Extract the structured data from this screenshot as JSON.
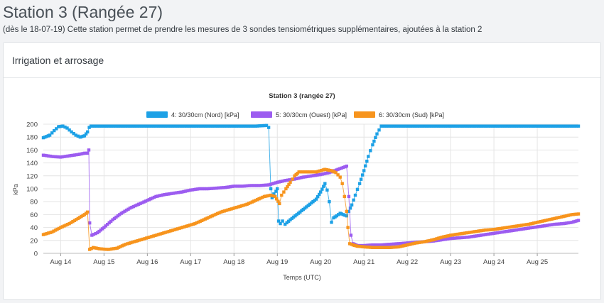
{
  "page": {
    "title": "Station 3 (Rangée 27)",
    "subtitle": "(dès le 18-07-19) Cette station permet de prendre les mesures de 3 sondes tensiométriques supplémentaires, ajoutées à la station 2"
  },
  "card": {
    "title": "Irrigation et arrosage"
  },
  "chart_data": {
    "type": "scatter",
    "title": "Station 3 (rangée 27)",
    "xlabel": "Temps (UTC)",
    "ylabel": "kPa",
    "ylim": [
      0,
      200
    ],
    "yticks": [
      0,
      20,
      40,
      60,
      80,
      100,
      120,
      140,
      160,
      180,
      200
    ],
    "xlim": [
      13.6,
      25.95
    ],
    "xticks": [
      {
        "x": 14,
        "label": "Aug 14"
      },
      {
        "x": 15,
        "label": "Aug 15"
      },
      {
        "x": 16,
        "label": "Aug 16"
      },
      {
        "x": 17,
        "label": "Aug 17"
      },
      {
        "x": 18,
        "label": "Aug 18"
      },
      {
        "x": 19,
        "label": "Aug 19"
      },
      {
        "x": 20,
        "label": "Aug 20"
      },
      {
        "x": 21,
        "label": "Aug 21"
      },
      {
        "x": 22,
        "label": "Aug 22"
      },
      {
        "x": 23,
        "label": "Aug 23"
      },
      {
        "x": 24,
        "label": "Aug 24"
      },
      {
        "x": 25,
        "label": "Aug 25"
      }
    ],
    "grid": true,
    "legend": "top-center",
    "series": [
      {
        "name": "4: 30/30cm (Nord) [kPa]",
        "color": "#1da1e6",
        "points": [
          [
            13.6,
            179
          ],
          [
            13.75,
            183
          ],
          [
            13.85,
            190
          ],
          [
            13.95,
            196
          ],
          [
            14.05,
            197
          ],
          [
            14.15,
            194
          ],
          [
            14.25,
            188
          ],
          [
            14.35,
            183
          ],
          [
            14.45,
            180
          ],
          [
            14.55,
            182
          ],
          [
            14.62,
            188
          ],
          [
            14.66,
            195
          ],
          [
            14.7,
            197
          ],
          [
            15.5,
            197
          ],
          [
            16.5,
            197
          ],
          [
            17.5,
            197
          ],
          [
            18.5,
            197
          ],
          [
            18.75,
            198
          ],
          [
            18.8,
            195
          ],
          [
            18.85,
            100
          ],
          [
            18.88,
            86
          ],
          [
            18.92,
            92
          ],
          [
            18.97,
            96
          ],
          [
            19.0,
            100
          ],
          [
            19.03,
            50
          ],
          [
            19.07,
            46
          ],
          [
            19.12,
            50
          ],
          [
            19.18,
            45
          ],
          [
            19.3,
            52
          ],
          [
            19.45,
            60
          ],
          [
            19.6,
            68
          ],
          [
            19.75,
            76
          ],
          [
            19.9,
            84
          ],
          [
            20.0,
            95
          ],
          [
            20.1,
            108
          ],
          [
            20.15,
            98
          ],
          [
            20.2,
            80
          ],
          [
            20.25,
            48
          ],
          [
            20.3,
            55
          ],
          [
            20.37,
            58
          ],
          [
            20.45,
            62
          ],
          [
            20.52,
            60
          ],
          [
            20.6,
            58
          ],
          [
            20.65,
            65
          ],
          [
            20.72,
            75
          ],
          [
            20.8,
            90
          ],
          [
            20.9,
            108
          ],
          [
            21.0,
            128
          ],
          [
            21.1,
            150
          ],
          [
            21.2,
            168
          ],
          [
            21.3,
            185
          ],
          [
            21.4,
            197
          ],
          [
            22.0,
            197
          ],
          [
            23.0,
            197
          ],
          [
            24.0,
            197
          ],
          [
            25.0,
            197
          ],
          [
            25.5,
            197
          ],
          [
            25.95,
            197
          ]
        ]
      },
      {
        "name": "5: 30/30cm (Ouest) [kPa]",
        "color": "#9c5cf0",
        "points": [
          [
            13.6,
            152
          ],
          [
            13.8,
            150
          ],
          [
            14.0,
            149
          ],
          [
            14.2,
            151
          ],
          [
            14.4,
            153
          ],
          [
            14.55,
            155
          ],
          [
            14.62,
            155
          ],
          [
            14.65,
            160
          ],
          [
            14.67,
            47
          ],
          [
            14.72,
            28
          ],
          [
            14.85,
            32
          ],
          [
            15.0,
            40
          ],
          [
            15.2,
            52
          ],
          [
            15.4,
            62
          ],
          [
            15.6,
            70
          ],
          [
            15.8,
            76
          ],
          [
            16.0,
            82
          ],
          [
            16.2,
            88
          ],
          [
            16.4,
            91
          ],
          [
            16.6,
            93
          ],
          [
            16.8,
            95
          ],
          [
            17.0,
            98
          ],
          [
            17.2,
            100
          ],
          [
            17.4,
            100
          ],
          [
            17.6,
            101
          ],
          [
            17.8,
            102
          ],
          [
            18.0,
            104
          ],
          [
            18.2,
            104
          ],
          [
            18.4,
            105
          ],
          [
            18.6,
            105
          ],
          [
            18.8,
            106
          ],
          [
            19.0,
            110
          ],
          [
            19.2,
            113
          ],
          [
            19.4,
            115
          ],
          [
            19.6,
            118
          ],
          [
            19.8,
            120
          ],
          [
            20.0,
            122
          ],
          [
            20.2,
            125
          ],
          [
            20.4,
            130
          ],
          [
            20.6,
            135
          ],
          [
            20.65,
            88
          ],
          [
            20.7,
            28
          ],
          [
            20.75,
            15
          ],
          [
            20.85,
            12
          ],
          [
            21.0,
            12
          ],
          [
            21.2,
            13
          ],
          [
            21.4,
            13
          ],
          [
            21.6,
            14
          ],
          [
            21.8,
            15
          ],
          [
            22.0,
            16
          ],
          [
            22.2,
            17
          ],
          [
            22.4,
            18
          ],
          [
            22.6,
            19
          ],
          [
            22.8,
            21
          ],
          [
            23.0,
            23
          ],
          [
            23.2,
            24
          ],
          [
            23.4,
            25
          ],
          [
            23.6,
            27
          ],
          [
            23.8,
            29
          ],
          [
            24.0,
            31
          ],
          [
            24.2,
            33
          ],
          [
            24.4,
            35
          ],
          [
            24.6,
            37
          ],
          [
            24.8,
            39
          ],
          [
            25.0,
            41
          ],
          [
            25.2,
            43
          ],
          [
            25.4,
            45
          ],
          [
            25.6,
            46
          ],
          [
            25.8,
            48
          ],
          [
            25.95,
            51
          ]
        ]
      },
      {
        "name": "6: 30/30cm (Sud) [kPa]",
        "color": "#f7941d",
        "points": [
          [
            13.6,
            29
          ],
          [
            13.8,
            33
          ],
          [
            14.0,
            40
          ],
          [
            14.2,
            46
          ],
          [
            14.4,
            54
          ],
          [
            14.55,
            60
          ],
          [
            14.62,
            64
          ],
          [
            14.67,
            6
          ],
          [
            14.75,
            9
          ],
          [
            14.9,
            7
          ],
          [
            15.1,
            6
          ],
          [
            15.3,
            8
          ],
          [
            15.5,
            14
          ],
          [
            15.7,
            18
          ],
          [
            15.9,
            22
          ],
          [
            16.1,
            26
          ],
          [
            16.3,
            30
          ],
          [
            16.5,
            34
          ],
          [
            16.7,
            38
          ],
          [
            16.9,
            42
          ],
          [
            17.1,
            46
          ],
          [
            17.3,
            52
          ],
          [
            17.5,
            58
          ],
          [
            17.7,
            64
          ],
          [
            17.9,
            68
          ],
          [
            18.1,
            72
          ],
          [
            18.3,
            76
          ],
          [
            18.5,
            82
          ],
          [
            18.7,
            88
          ],
          [
            18.85,
            90
          ],
          [
            18.95,
            88
          ],
          [
            19.05,
            77
          ],
          [
            19.1,
            90
          ],
          [
            19.2,
            100
          ],
          [
            19.3,
            110
          ],
          [
            19.4,
            120
          ],
          [
            19.5,
            126
          ],
          [
            19.7,
            126
          ],
          [
            19.9,
            126
          ],
          [
            20.1,
            130
          ],
          [
            20.25,
            128
          ],
          [
            20.35,
            125
          ],
          [
            20.45,
            118
          ],
          [
            20.5,
            108
          ],
          [
            20.55,
            88
          ],
          [
            20.6,
            65
          ],
          [
            20.63,
            40
          ],
          [
            20.67,
            15
          ],
          [
            20.75,
            13
          ],
          [
            20.85,
            11
          ],
          [
            21.0,
            10
          ],
          [
            21.2,
            9
          ],
          [
            21.4,
            9
          ],
          [
            21.6,
            9
          ],
          [
            21.8,
            10
          ],
          [
            22.0,
            13
          ],
          [
            22.2,
            16
          ],
          [
            22.4,
            18
          ],
          [
            22.6,
            21
          ],
          [
            22.8,
            25
          ],
          [
            23.0,
            28
          ],
          [
            23.2,
            30
          ],
          [
            23.4,
            32
          ],
          [
            23.6,
            34
          ],
          [
            23.8,
            36
          ],
          [
            24.0,
            37
          ],
          [
            24.2,
            39
          ],
          [
            24.4,
            41
          ],
          [
            24.6,
            43
          ],
          [
            24.8,
            45
          ],
          [
            25.0,
            48
          ],
          [
            25.2,
            51
          ],
          [
            25.4,
            54
          ],
          [
            25.6,
            57
          ],
          [
            25.8,
            60
          ],
          [
            25.95,
            61
          ]
        ]
      }
    ]
  }
}
